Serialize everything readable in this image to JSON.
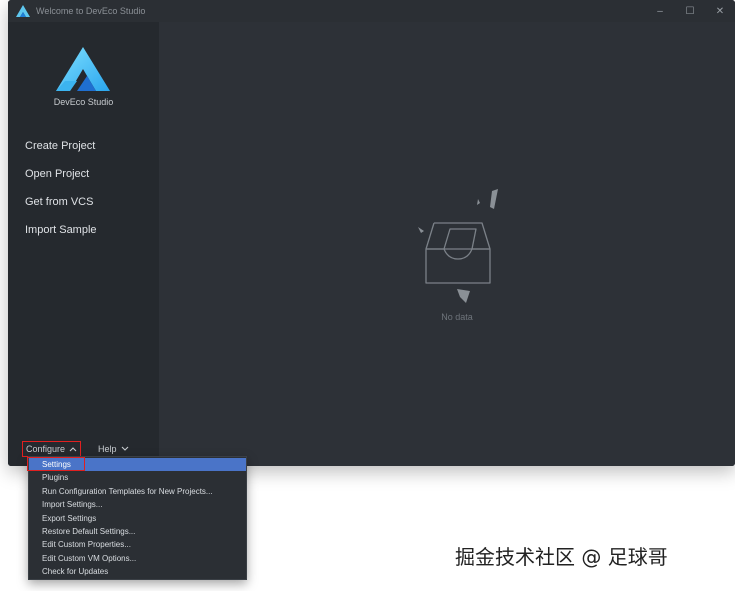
{
  "window": {
    "title": "Welcome to DevEco Studio",
    "controls": [
      "–",
      "☐",
      "✕"
    ]
  },
  "sidebar": {
    "brand_name": "DevEco Studio",
    "items": [
      {
        "label": "Create Project"
      },
      {
        "label": "Open Project"
      },
      {
        "label": "Get from VCS"
      },
      {
        "label": "Import Sample"
      }
    ],
    "configure_label": "Configure",
    "help_label": "Help"
  },
  "main": {
    "empty_text": "No data"
  },
  "configure_menu": {
    "items": [
      {
        "label": "Settings",
        "selected": true
      },
      {
        "label": "Plugins"
      },
      {
        "label": "Run Configuration Templates for New Projects..."
      },
      {
        "label": "Import Settings..."
      },
      {
        "label": "Export Settings"
      },
      {
        "label": "Restore Default Settings..."
      },
      {
        "label": "Edit Custom Properties..."
      },
      {
        "label": "Edit Custom VM Options..."
      },
      {
        "label": "Check for Updates"
      }
    ]
  },
  "watermark": "掘金技术社区 @ 足球哥",
  "colors": {
    "background": "#2d3137",
    "sidebar": "#25292e",
    "selection": "#4a74c8",
    "highlight_box": "#e02020",
    "logo_light": "#5ec8f0",
    "logo_dark": "#1f7fd8"
  }
}
